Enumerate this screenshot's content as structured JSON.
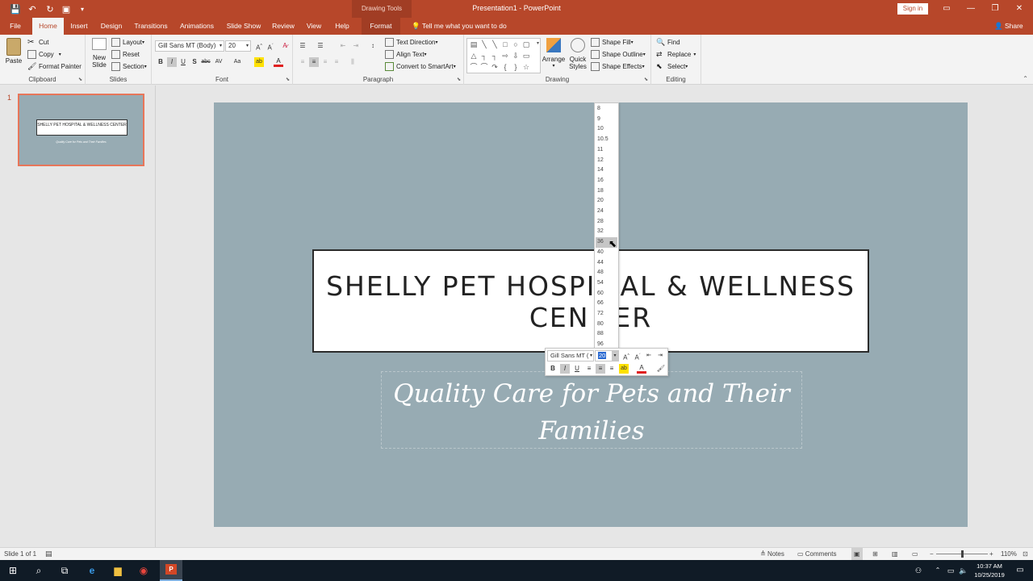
{
  "window": {
    "title": "Presentation1  -  PowerPoint",
    "context_tab_group": "Drawing Tools",
    "sign_in": "Sign in"
  },
  "tabs": [
    "File",
    "Home",
    "Insert",
    "Design",
    "Transitions",
    "Animations",
    "Slide Show",
    "Review",
    "View",
    "Help",
    "Format"
  ],
  "active_tab": "Home",
  "tell_me": "Tell me what you want to do",
  "share": "Share",
  "ribbon": {
    "clipboard": {
      "label": "Clipboard",
      "paste": "Paste",
      "cut": "Cut",
      "copy": "Copy",
      "format_painter": "Format Painter"
    },
    "slides": {
      "label": "Slides",
      "new_slide": "New",
      "new_slide_2": "Slide",
      "layout": "Layout",
      "reset": "Reset",
      "section": "Section"
    },
    "font": {
      "label": "Font",
      "font_name": "Gill Sans MT (Body)",
      "font_size": "20"
    },
    "paragraph": {
      "label": "Paragraph",
      "text_direction": "Text Direction",
      "align_text": "Align Text",
      "convert_smartart": "Convert to SmartArt"
    },
    "drawing": {
      "label": "Drawing",
      "arrange": "Arrange",
      "quick_styles": "Quick",
      "quick_styles_2": "Styles",
      "shape_fill": "Shape Fill",
      "shape_outline": "Shape Outline",
      "shape_effects": "Shape Effects"
    },
    "editing": {
      "label": "Editing",
      "find": "Find",
      "replace": "Replace",
      "select": "Select"
    }
  },
  "thumbnail": {
    "number": "1",
    "title": "SHELLY PET HOSPITAL & WELLNESS CENTER",
    "subtitle": "Quality Care for Pets and Their Families"
  },
  "slide": {
    "title_line1": "SHELLY PET HOSPI",
    "title_line1b": "AL & WELLNESS",
    "title_line2a": "CEN",
    "title_line2b": "ER",
    "subtitle_line1": "Quality Care for Pets and Their",
    "subtitle_line2": "Families"
  },
  "font_size_list": {
    "items": [
      "8",
      "9",
      "10",
      "10.5",
      "11",
      "12",
      "14",
      "16",
      "18",
      "20",
      "24",
      "28",
      "32",
      "36",
      "40",
      "44",
      "48",
      "54",
      "60",
      "66",
      "72",
      "80",
      "88",
      "96"
    ],
    "highlighted": "36"
  },
  "mini_toolbar": {
    "font_name": "Gill Sans MT (",
    "font_size": "20"
  },
  "status": {
    "slide_info": "Slide 1 of 1",
    "notes": "Notes",
    "comments": "Comments",
    "zoom": "110%"
  },
  "taskbar": {
    "time": "10:37 AM",
    "date": "10/25/2019"
  },
  "colors": {
    "accent": "#b7472a",
    "slide_bg": "#97abb3",
    "taskbar": "#101b26"
  }
}
